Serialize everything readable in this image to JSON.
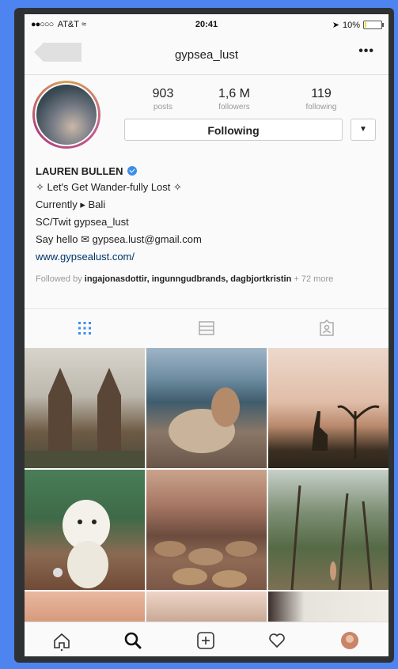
{
  "status_bar": {
    "carrier": "AT&T",
    "time": "20:41",
    "battery": "10%",
    "battery_level": 0.1
  },
  "nav": {
    "title": "gypsea_lust",
    "more": "•••"
  },
  "stats": [
    {
      "value": "903",
      "label": "posts"
    },
    {
      "value": "1,6 M",
      "label": "followers"
    },
    {
      "value": "119",
      "label": "following"
    }
  ],
  "follow_button": "Following",
  "bio": {
    "name": "LAUREN BULLEN",
    "line1": "✧ Let's Get Wander-fully Lost ✧",
    "line2": "Currently ▸ Bali",
    "line3": "SC/Twit gypsea_lust",
    "line4": "Say hello ✉ gypsea.lust@gmail.com",
    "website": "www.gypsealust.com/"
  },
  "followed_by": {
    "prefix": "Followed by",
    "names": "ingajonasdottir, ingunngudbrands, dagbjortkristin",
    "suffix": "+ 72 more"
  },
  "tabs": [
    "grid-icon",
    "list-icon",
    "tagged-icon"
  ],
  "bottom_nav": [
    "home-icon",
    "search-icon",
    "add-icon",
    "heart-icon",
    "profile-avatar"
  ],
  "colors": {
    "background": "#4d84f0",
    "frame": "#2f3234",
    "link": "#003569",
    "verified": "#3d8ee5"
  }
}
